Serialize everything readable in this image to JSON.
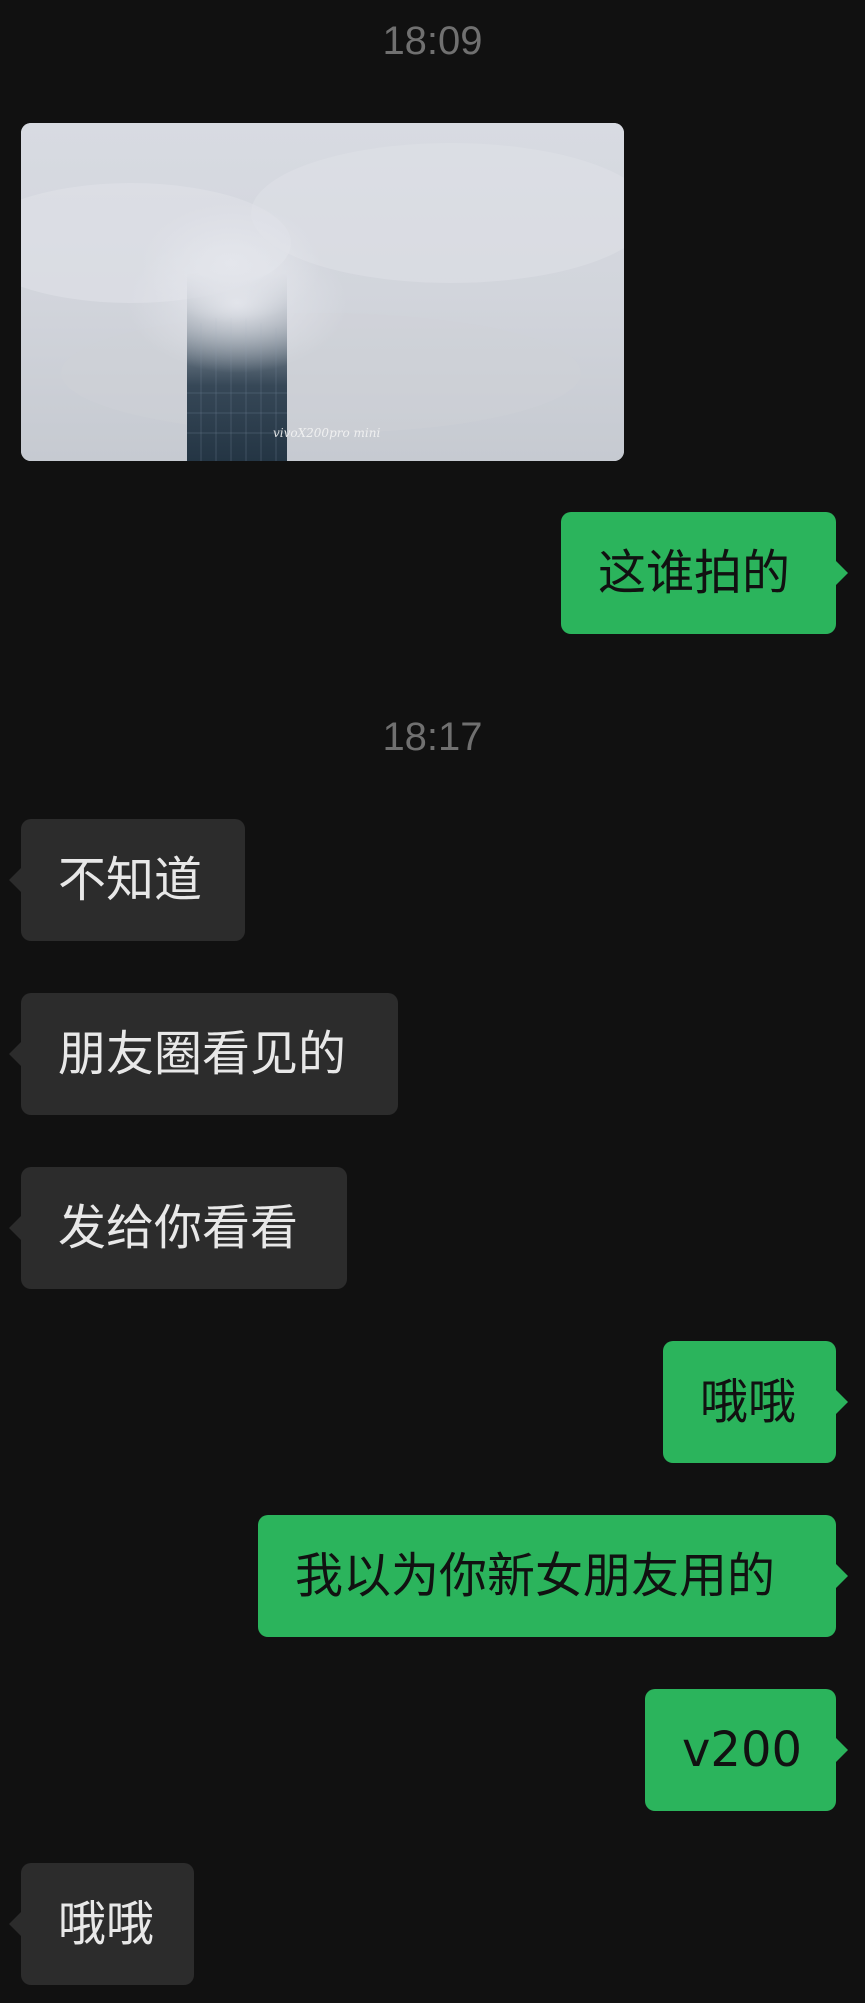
{
  "messages": {
    "time1": "18:09",
    "time2": "18:17",
    "photo_watermark": "vivoX200pro mini",
    "out1": "这谁拍的",
    "in1": "不知道",
    "in2": "朋友圈看见的",
    "in3": "发给你看看",
    "out2": "哦哦",
    "out3": "我以为你新女朋友用的",
    "out4": "v200",
    "in4": "哦哦"
  },
  "colors": {
    "background": "#111111",
    "incoming_bubble": "#2c2c2c",
    "outgoing_bubble": "#2bb45c",
    "timestamp_text": "#707070"
  }
}
